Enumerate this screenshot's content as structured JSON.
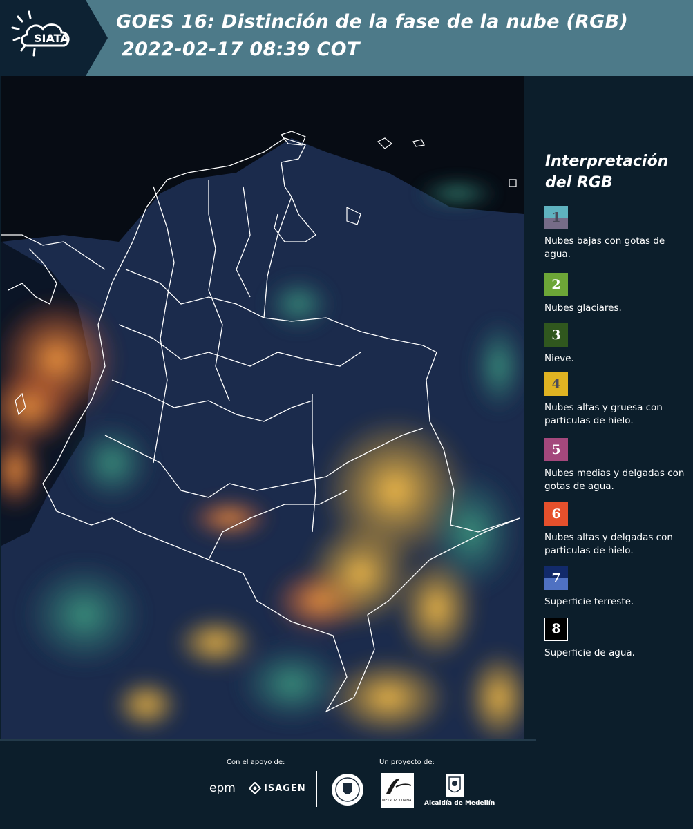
{
  "header": {
    "logo_text": "SIATA",
    "title_line1": "GOES 16: Distinción de la fase de la nube (RGB)",
    "title_line2": "2022-02-17 08:39 COT"
  },
  "legend": {
    "title": "Interpretación del RGB",
    "items": [
      {
        "number": "1",
        "label": "Nubes bajas con gotas de agua.",
        "color_top": "#5fb2bf",
        "color_bottom": "#766c88"
      },
      {
        "number": "2",
        "label": "Nubes glaciares.",
        "color": "#6da637"
      },
      {
        "number": "3",
        "label": "Nieve.",
        "color": "#30571e"
      },
      {
        "number": "4",
        "label": "Nubes altas y gruesa con particulas de hielo.",
        "color": "#e0b322"
      },
      {
        "number": "5",
        "label": "Nubes medias y delgadas con gotas de agua.",
        "color": "#a4487c"
      },
      {
        "number": "6",
        "label": "Nubes altas y delgadas con particulas de hielo.",
        "color": "#e6502c"
      },
      {
        "number": "7",
        "label": "Superficie terreste.",
        "color_top": "#122a6a",
        "color_bottom": "#4f71c2"
      },
      {
        "number": "8",
        "label": "Superficie de agua.",
        "color": "#000000"
      }
    ]
  },
  "footer": {
    "support_label": "Con el apoyo de:",
    "project_label": "Un proyecto de:",
    "sponsor_epm": "epm",
    "sponsor_isagen": "ISAGEN",
    "area_logo_text": "METROPOLITANA",
    "medellin_label": "Alcaldía de Medellín"
  }
}
